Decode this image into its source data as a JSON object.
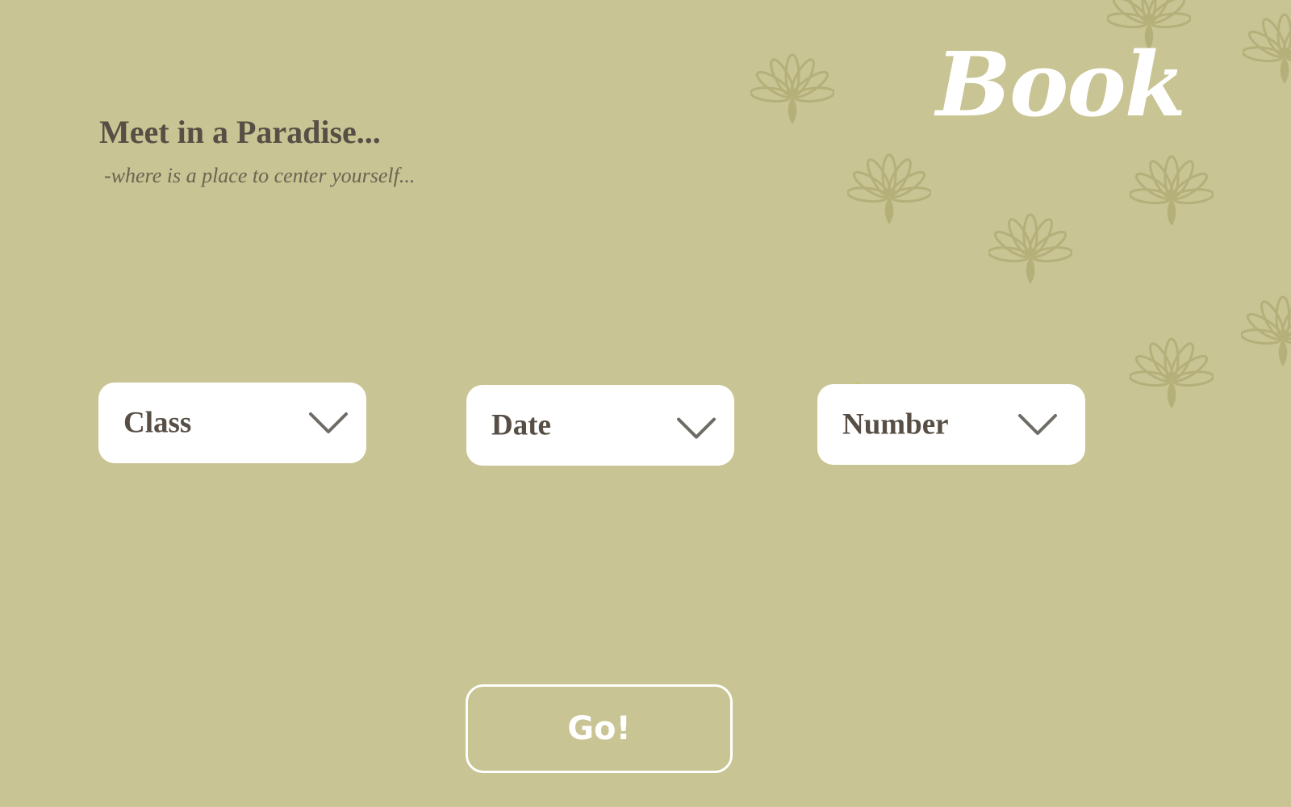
{
  "hero": {
    "heading": "Meet in a Paradise...",
    "tagline": "-where is a place to center yourself..."
  },
  "brand": {
    "title": "Book"
  },
  "form": {
    "class_select": {
      "value": "Class",
      "icon": "chevron-down-icon"
    },
    "date_select": {
      "value": "Date",
      "icon": "chevron-down-icon"
    },
    "number_select": {
      "value": "Number",
      "icon": "chevron-down-icon"
    },
    "submit_label": "Go!"
  },
  "decorations": {
    "icon": "lotus-flower-icon"
  },
  "colors": {
    "background": "#c8c493",
    "decor": "#b5b07a",
    "heading_text": "#574f45",
    "tagline_text": "#6b6552",
    "field_background": "#ffffff",
    "chevron": "#6f6b66",
    "button_text": "#ffffff"
  }
}
